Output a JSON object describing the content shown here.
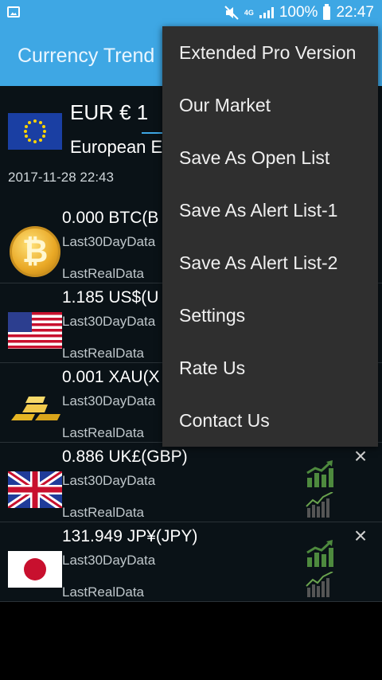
{
  "status_bar": {
    "battery": "100%",
    "time": "22:47",
    "network": "4G"
  },
  "app": {
    "title": "Currency Trend"
  },
  "base": {
    "amount": "EUR € 1",
    "name": "European E",
    "timestamp": "2017-11-28 22:43"
  },
  "rows": [
    {
      "value": "0.000 BTC(B",
      "last30": "Last30DayData",
      "lastreal": "LastRealData"
    },
    {
      "value": "1.185 US$(U",
      "last30": "Last30DayData",
      "lastreal": "LastRealData"
    },
    {
      "value": "0.001 XAU(X",
      "last30": "Last30DayData",
      "lastreal": "LastRealData"
    },
    {
      "value": "0.886 UK£(GBP)",
      "last30": "Last30DayData",
      "lastreal": "LastRealData"
    },
    {
      "value": "131.949 JP¥(JPY)",
      "last30": "Last30DayData",
      "lastreal": "LastRealData"
    }
  ],
  "menu": {
    "items": [
      "Extended Pro Version",
      "Our Market",
      "Save As Open List",
      "Save As Alert List-1",
      "Save As Alert List-2",
      "Settings",
      "Rate Us",
      "Contact Us"
    ]
  },
  "icons": {
    "close": "close-icon",
    "chart": "chart-icon",
    "trend": "trend-icon"
  },
  "colors": {
    "accent": "#3ea7e4",
    "menu_bg": "#2f2f2f",
    "chart_green": "#4e8a3e"
  }
}
